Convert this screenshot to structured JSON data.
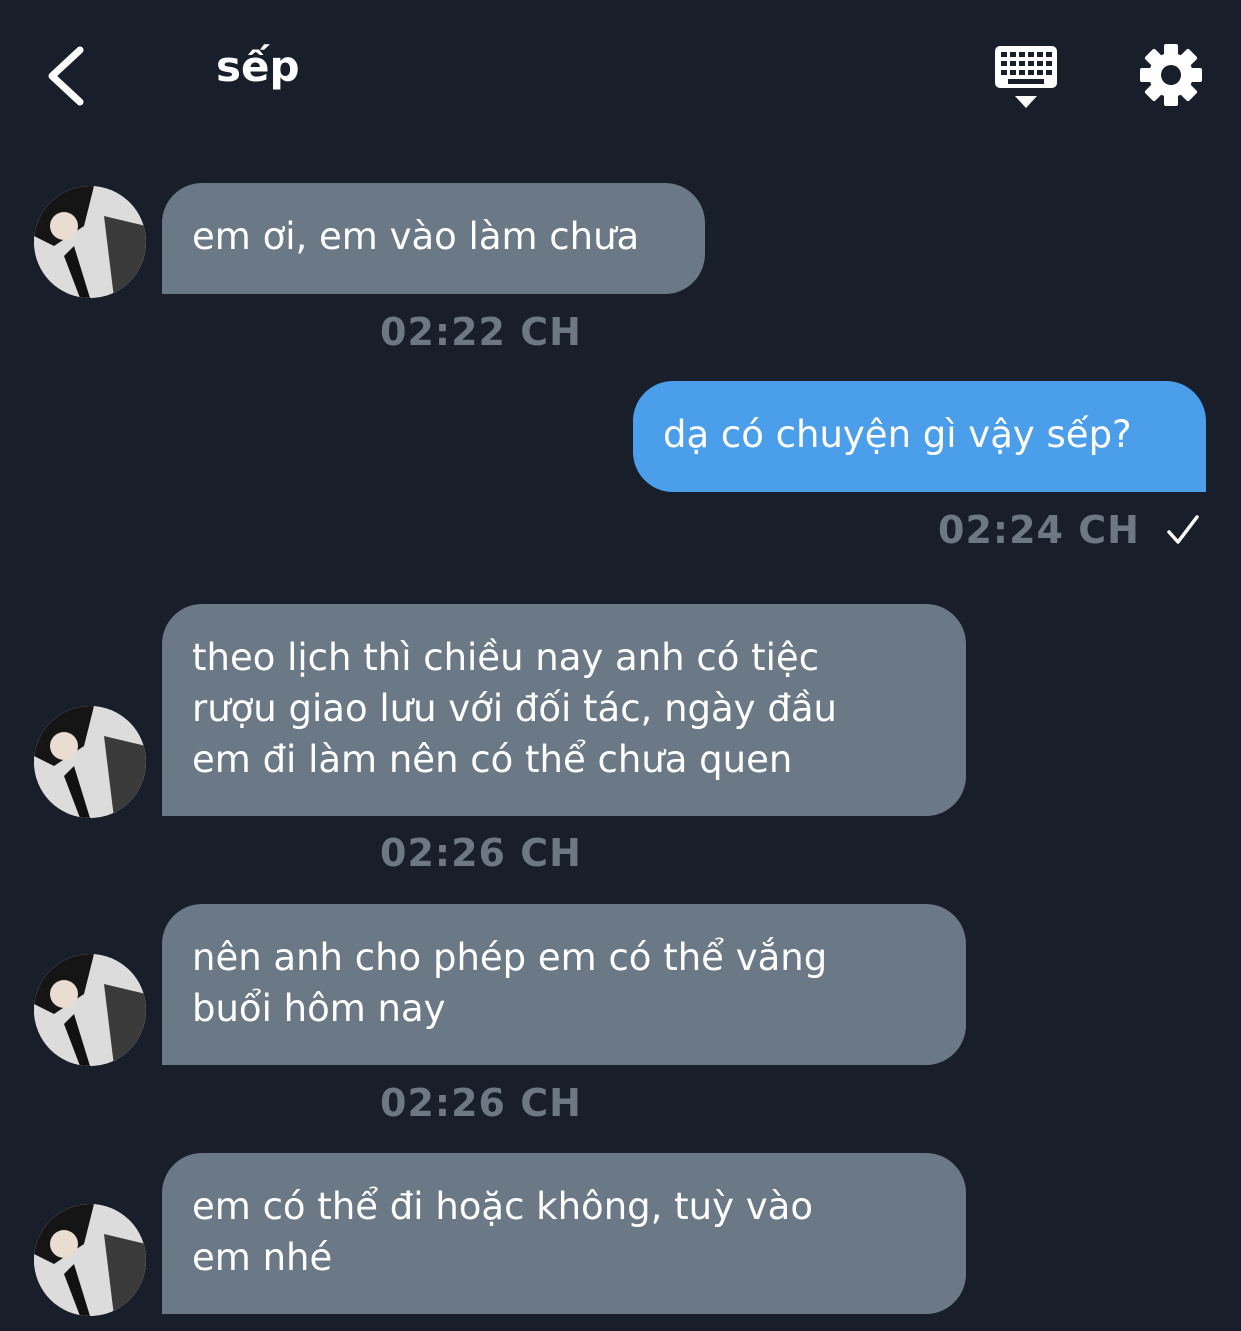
{
  "header": {
    "title": "sếp",
    "back_icon": "chevron-left-icon",
    "keyboard_icon": "keyboard-icon",
    "settings_icon": "gear-icon"
  },
  "colors": {
    "background": "#181f2a",
    "incoming_bubble": "#6b7885",
    "outgoing_bubble": "#4b9eea",
    "timestamp": "#6d7884"
  },
  "messages": [
    {
      "direction": "incoming",
      "text": "em ơi, em vào làm chưa",
      "time": "02:22 CH"
    },
    {
      "direction": "outgoing",
      "text": "dạ có chuyện gì vậy sếp?",
      "time": "02:24 CH",
      "status_icon": "check-icon"
    },
    {
      "direction": "incoming",
      "text": "theo lịch thì chiều nay anh có tiệc\nrượu giao lưu với đối tác, ngày đầu\nem đi làm nên có thể chưa quen",
      "time": "02:26 CH"
    },
    {
      "direction": "incoming",
      "text": "nên anh cho phép em có thể vắng\nbuổi hôm nay",
      "time": "02:26 CH"
    },
    {
      "direction": "incoming",
      "text": "em có thể đi hoặc không, tuỳ vào\nem nhé",
      "time": ""
    }
  ]
}
